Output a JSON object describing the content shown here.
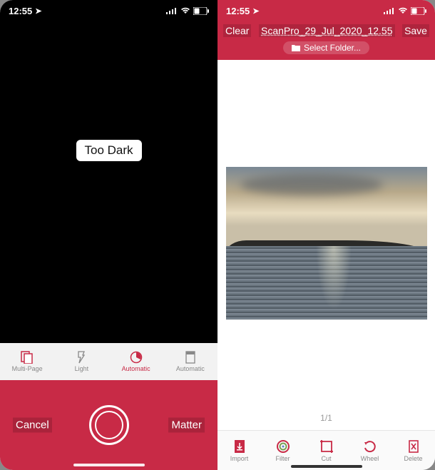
{
  "left": {
    "status": {
      "time": "12:55",
      "loc_icon": "➤"
    },
    "camera": {
      "warning": "Too Dark"
    },
    "toolbar": {
      "items": [
        {
          "label": "Multi-Page",
          "icon": "multipage"
        },
        {
          "label": "Light",
          "icon": "flash"
        },
        {
          "label": "Automatic",
          "icon": "auto",
          "active": true
        },
        {
          "label": "Automatic",
          "icon": "page"
        }
      ]
    },
    "bottom": {
      "cancel": "Cancel",
      "matter": "Matter"
    }
  },
  "right": {
    "status": {
      "time": "12:55",
      "loc_icon": "➤"
    },
    "header": {
      "clear": "Clear",
      "title": "ScanPro_29_Jul_2020_12.55",
      "save": "Save",
      "select_folder": "Select Folder..."
    },
    "page_indicator": "1/1",
    "tools": [
      {
        "label": "Import",
        "icon": "import"
      },
      {
        "label": "Filter",
        "icon": "filter"
      },
      {
        "label": "Cut",
        "icon": "cut"
      },
      {
        "label": "Wheel",
        "icon": "undo"
      },
      {
        "label": "Delete",
        "icon": "delete"
      }
    ]
  },
  "colors": {
    "accent": "#c82a46"
  }
}
